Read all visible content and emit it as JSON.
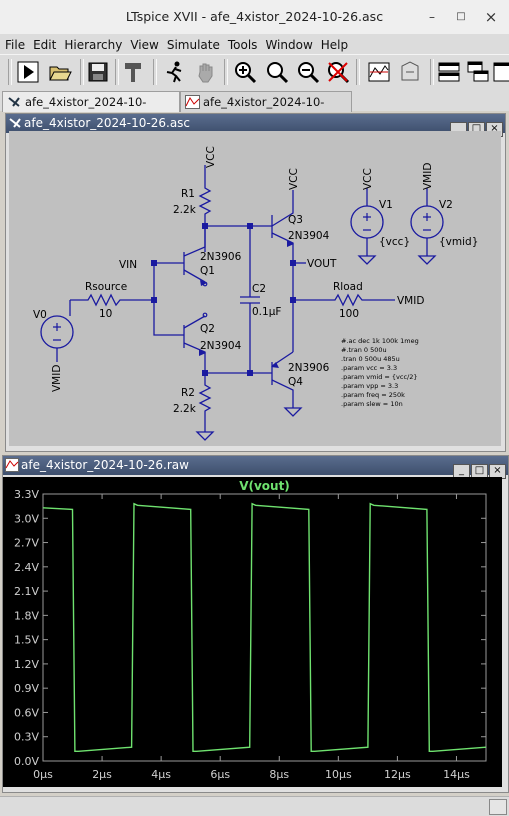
{
  "window": {
    "title": "LTspice XVII - afe_4xistor_2024-10-26.asc",
    "minimize": "–",
    "maximize": "□",
    "close": "×"
  },
  "menu": [
    "File",
    "Edit",
    "Hierarchy",
    "View",
    "Simulate",
    "Tools",
    "Window",
    "Help"
  ],
  "toolbar_icons": [
    "run-icon",
    "open-icon",
    "save-icon",
    "control-panel-hammer-icon",
    "halt-running-icon",
    "pan-hand-icon",
    "zoom-in-icon",
    "zoom-area-icon",
    "zoom-out-icon",
    "zoom-cancel-icon",
    "autorange-icon",
    "tile-icon",
    "horizontal-window-icon",
    "cascade-icon",
    "vertical-window-icon"
  ],
  "tabs": [
    {
      "label": "afe_4xistor_2024-10-26.asc",
      "active": true
    },
    {
      "label": "afe_4xistor_2024-10-26.raw",
      "active": false
    }
  ],
  "schematic_window": {
    "title": "afe_4xistor_2024-10-26.asc",
    "btn_min": "_",
    "btn_max": "□",
    "btn_close": "×",
    "labels": {
      "vcc_top": "VCC",
      "r1_name": "R1",
      "r1_value": "2.2k",
      "q1_model": "2N3906",
      "q1_name": "Q1",
      "vin": "VIN",
      "rsource_name": "Rsource",
      "rsource_value": "10",
      "v0_name": "V0",
      "vmid_bottom": "VMID",
      "q2_name": "Q2",
      "q2_model": "2N3904",
      "r2_name": "R2",
      "r2_value": "2.2k",
      "vcc_q3": "VCC",
      "q3_name": "Q3",
      "q3_model": "2N3904",
      "c2_name": "C2",
      "c2_value": "0.1µF",
      "vout": "VOUT",
      "rload_name": "Rload",
      "rload_value": "100",
      "vmid_right": "VMID",
      "q4_model": "2N3906",
      "q4_name": "Q4",
      "v1_net": "VCC",
      "v1_name": "V1",
      "v1_value": "{vcc}",
      "v2_net": "VMID",
      "v2_name": "V2",
      "v2_value": "{vmid}"
    },
    "directives": [
      "#.ac dec 1k 100k 1meg",
      "#.tran 0 500u",
      ".tran 0 500u 485u",
      ".param vcc = 3.3",
      ".param vmid = {vcc/2}",
      ".param vpp = 3.3",
      ".param freq = 250k",
      ".param slew = 10n"
    ]
  },
  "waveform_window": {
    "title": "afe_4xistor_2024-10-26.raw",
    "btn_min": "_",
    "btn_max": "□",
    "btn_close": "×"
  },
  "chart_data": {
    "type": "line",
    "title": "V(vout)",
    "xlabel": "",
    "ylabel": "",
    "xlim": [
      0,
      15
    ],
    "ylim": [
      0,
      3.3
    ],
    "x_ticks": [
      "0µs",
      "2µs",
      "4µs",
      "6µs",
      "8µs",
      "10µs",
      "12µs",
      "14µs"
    ],
    "y_ticks": [
      "0.0V",
      "0.3V",
      "0.6V",
      "0.9V",
      "1.2V",
      "1.5V",
      "1.8V",
      "2.1V",
      "2.4V",
      "2.7V",
      "3.0V",
      "3.3V"
    ],
    "grid": false,
    "series": [
      {
        "name": "V(vout)",
        "color": "#6fe26f",
        "x": [
          0,
          1.0,
          1.08,
          1.2,
          3.0,
          3.08,
          3.2,
          5.0,
          5.08,
          5.2,
          7.0,
          7.08,
          7.2,
          9.0,
          9.08,
          9.2,
          11.0,
          11.08,
          11.2,
          13.0,
          13.08,
          13.2,
          15.0
        ],
        "y": [
          3.13,
          3.11,
          0.12,
          0.12,
          0.17,
          3.18,
          3.16,
          3.11,
          0.12,
          0.12,
          0.17,
          3.18,
          3.16,
          3.11,
          0.12,
          0.12,
          0.17,
          3.18,
          3.16,
          3.11,
          0.12,
          0.12,
          0.17
        ]
      }
    ]
  },
  "colors": {
    "wire": "#1a1aa0",
    "component": "#1a1aa0",
    "schematic_bg": "#c0c0c0",
    "plot_bg": "#000000",
    "trace": "#6fe26f"
  }
}
